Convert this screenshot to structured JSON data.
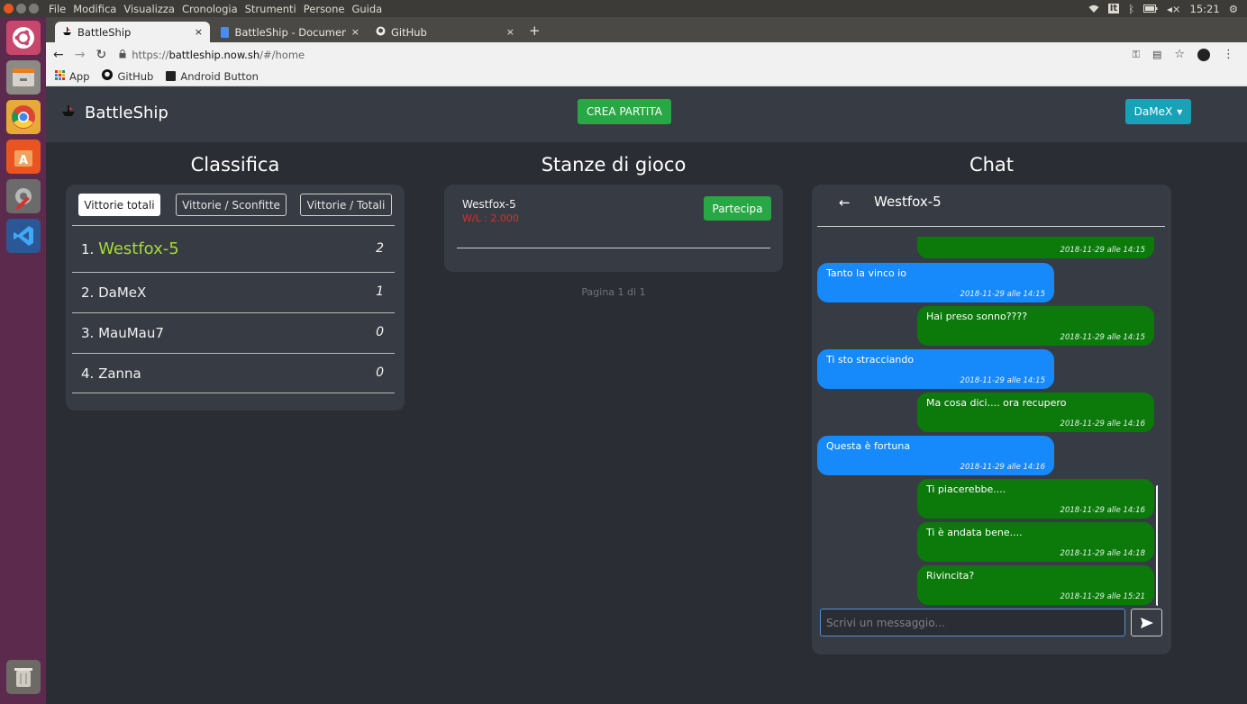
{
  "os": {
    "menu": [
      "File",
      "Modifica",
      "Visualizza",
      "Cronologia",
      "Strumenti",
      "Persone",
      "Guida"
    ],
    "tray": {
      "lang": "It",
      "time": "15:21"
    }
  },
  "browser": {
    "tabs": [
      {
        "label": "BattleShip"
      },
      {
        "label": "BattleShip - Documenti G"
      },
      {
        "label": "GitHub"
      }
    ],
    "new_tab": "+",
    "url_prefix": "https://",
    "url_host": "battleship.now.sh",
    "url_path": "/#/home",
    "bookmarks": [
      "App",
      "GitHub",
      "Android Button"
    ]
  },
  "app": {
    "brand": "BattleShip",
    "create_button": "CREA PARTITA",
    "user": "DaMeX"
  },
  "leaderboard": {
    "title": "Classifica",
    "filters": [
      "Vittorie totali",
      "Vittorie / Sconfitte",
      "Vittorie / Totali"
    ],
    "rows": [
      {
        "name": "1. Westfox-5",
        "score": "2"
      },
      {
        "name": "2. DaMeX",
        "score": "1"
      },
      {
        "name": "3. MauMau7",
        "score": "0"
      },
      {
        "name": "4. Zanna",
        "score": "0"
      }
    ]
  },
  "rooms": {
    "title": "Stanze di gioco",
    "items": [
      {
        "name": "Westfox-5",
        "ratio": "W/L : 2.000",
        "join": "Partecipa"
      }
    ],
    "pagination": "Pagina 1 di 1"
  },
  "chat": {
    "title": "Chat",
    "back": "←",
    "opponent": "Westfox-5",
    "messages": [
      {
        "from": "me",
        "text": "",
        "time": "2018-11-29 alle 14:15"
      },
      {
        "from": "other",
        "text": "Tanto la vinco io",
        "time": "2018-11-29 alle 14:15"
      },
      {
        "from": "me",
        "text": "Hai preso sonno????",
        "time": "2018-11-29 alle 14:15"
      },
      {
        "from": "other",
        "text": "Ti sto stracciando",
        "time": "2018-11-29 alle 14:15"
      },
      {
        "from": "me",
        "text": "Ma cosa dici.... ora recupero",
        "time": "2018-11-29 alle 14:16"
      },
      {
        "from": "other",
        "text": "Questa è fortuna",
        "time": "2018-11-29 alle 14:16"
      },
      {
        "from": "me",
        "text": "Ti piacerebbe....",
        "time": "2018-11-29 alle 14:16"
      },
      {
        "from": "me",
        "text": "Ti è andata bene....",
        "time": "2018-11-29 alle 14:18"
      },
      {
        "from": "me",
        "text": "Rivincita?",
        "time": "2018-11-29 alle 15:21"
      }
    ],
    "input_placeholder": "Scrivi un messaggio..."
  },
  "colors": {
    "leader_highlight": "#a6d93a",
    "ratio_red": "#e32a2a",
    "me_bubble": "#0b7a0b",
    "other_bubble": "#1689fb"
  }
}
